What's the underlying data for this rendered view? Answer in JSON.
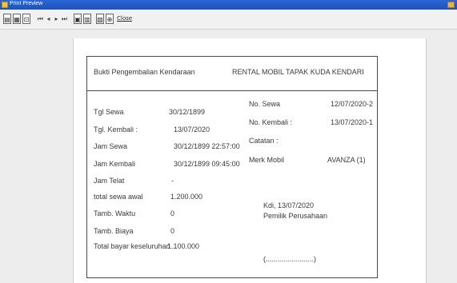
{
  "window": {
    "title": "Print Preview"
  },
  "toolbar": {
    "close_label": "Close"
  },
  "receipt": {
    "heading": "Bukti Pengembalian Kendaraan",
    "company": "RENTAL MOBIL TAPAK KUDA KENDARI",
    "left_rows": [
      {
        "label": "Tgl Sewa",
        "value": "30/12/1899"
      },
      {
        "label": "Tgl. Kembali :",
        "value": "13/07/2020"
      },
      {
        "label": "Jam Sewa",
        "value": "30/12/1899 22:57:00"
      },
      {
        "label": "Jam Kembali",
        "value": "30/12/1899 09:45:00"
      },
      {
        "label": "Jam Telat",
        "value": "-"
      },
      {
        "label": "total sewa awal",
        "value": "1.200.000"
      },
      {
        "label": "Tamb. Waktu",
        "value": "0"
      },
      {
        "label": "Tamb. Biaya",
        "value": "0"
      },
      {
        "label": "Total bayar keseluruhan",
        "value": "1.100.000"
      }
    ],
    "right_rows": [
      {
        "label": "No. Sewa",
        "value": "12/07/2020-2"
      },
      {
        "label": "No. Kembali :",
        "value": "13/07/2020-1"
      },
      {
        "label": "Catatan :",
        "value": ""
      },
      {
        "label": "Merk Mobil",
        "value": "AVANZA (1)"
      }
    ],
    "city_date": "Kdi,  13/07/2020",
    "owner_title": "Pemilik Perusahaan",
    "signature_line": "(........................)"
  }
}
